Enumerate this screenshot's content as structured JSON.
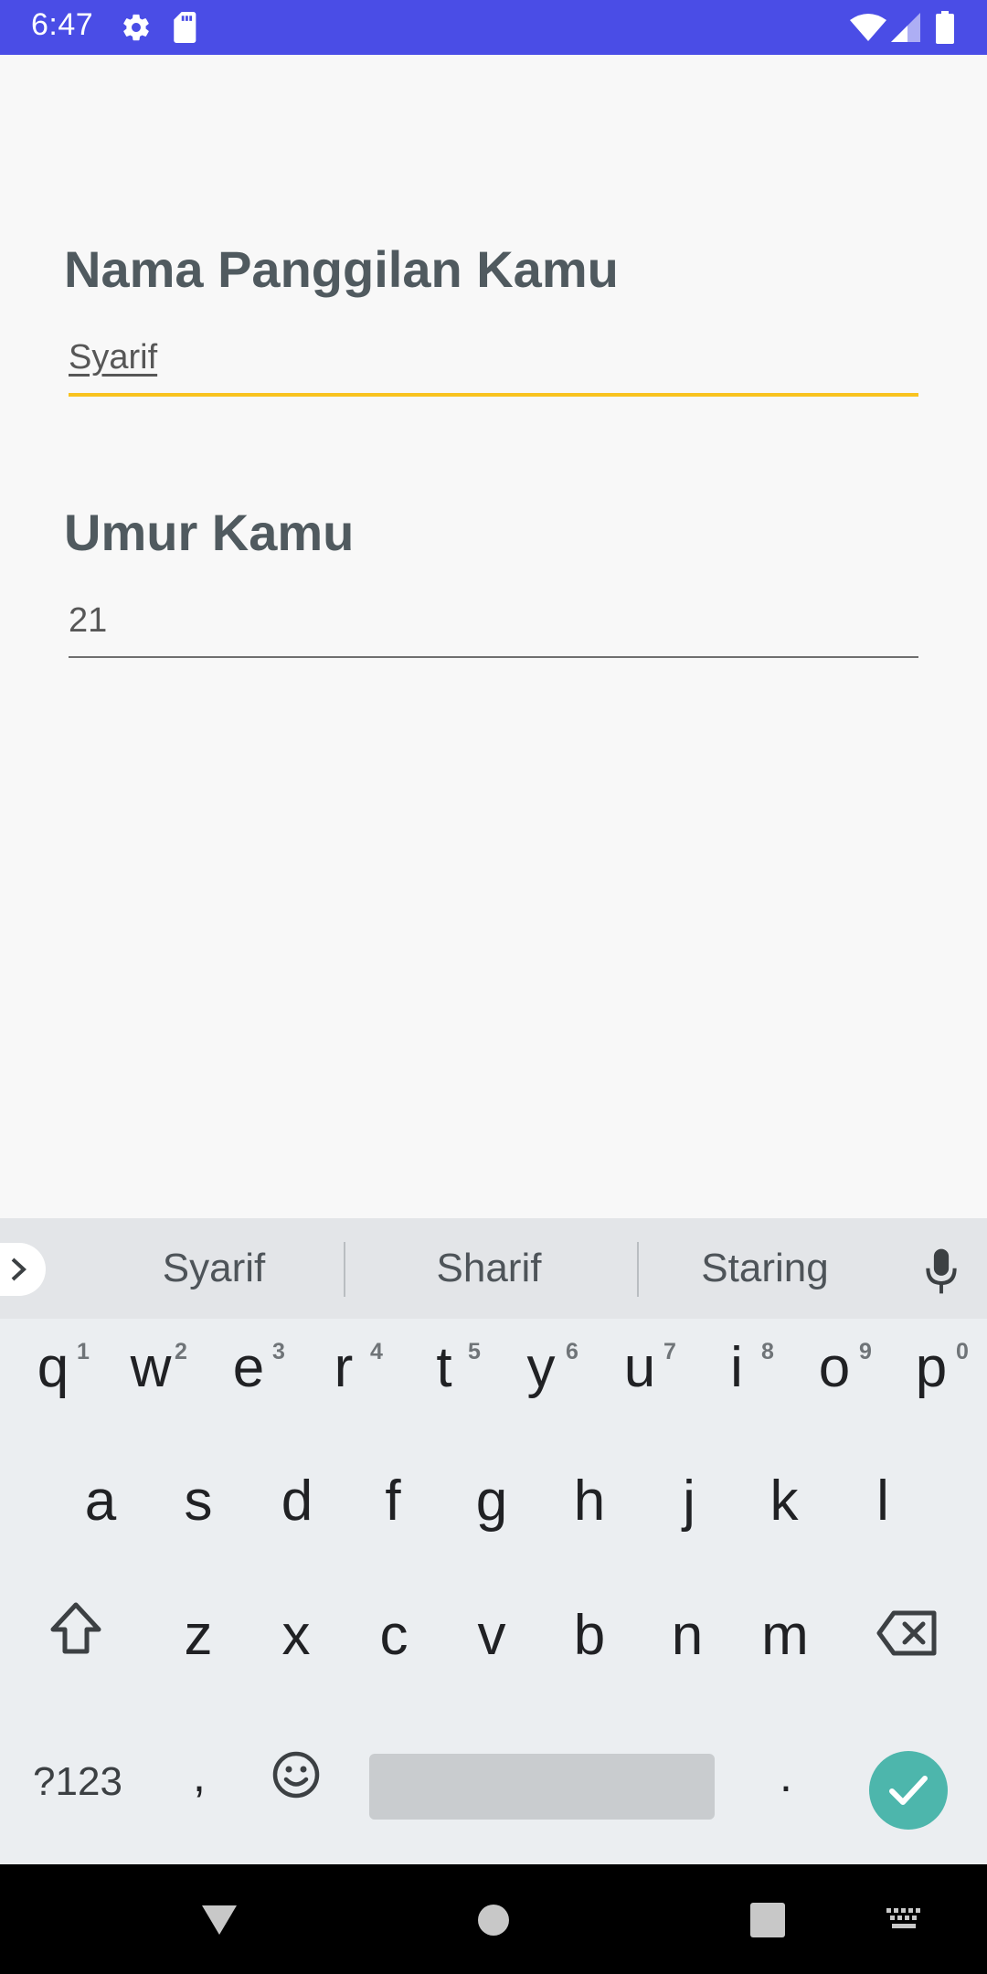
{
  "status_bar": {
    "time": "6:47"
  },
  "form": {
    "nickname": {
      "label": "Nama Panggilan Kamu",
      "value": "Syarif"
    },
    "age": {
      "label": "Umur Kamu",
      "value": "21"
    }
  },
  "keyboard": {
    "suggestions": [
      "Syarif",
      "Sharif",
      "Staring"
    ],
    "row1": [
      "q",
      "w",
      "e",
      "r",
      "t",
      "y",
      "u",
      "i",
      "o",
      "p"
    ],
    "row1_numbers": [
      "1",
      "2",
      "3",
      "4",
      "5",
      "6",
      "7",
      "8",
      "9",
      "0"
    ],
    "row2": [
      "a",
      "s",
      "d",
      "f",
      "g",
      "h",
      "j",
      "k",
      "l"
    ],
    "row3": [
      "z",
      "x",
      "c",
      "v",
      "b",
      "n",
      "m"
    ],
    "symbols_label": "?123",
    "comma": ",",
    "period": "."
  },
  "colors": {
    "status_bar": "#4a4de6",
    "active_underline": "#f9c31f",
    "enter_key": "#4db6ac"
  }
}
